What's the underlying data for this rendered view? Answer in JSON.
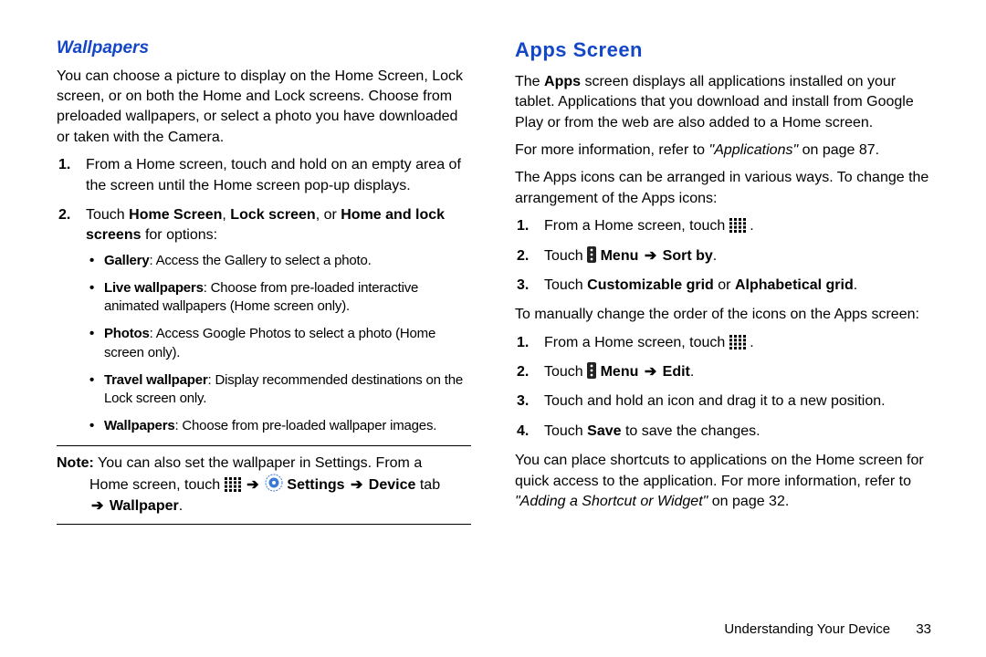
{
  "left": {
    "heading": "Wallpapers",
    "intro": "You can choose a picture to display on the Home Screen, Lock screen, or on both the Home and Lock screens. Choose from preloaded wallpapers, or select a photo you have downloaded or taken with the Camera.",
    "step1": "From a Home screen, touch and hold on an empty area of the screen until the Home screen pop-up displays.",
    "step2_pre": "Touch ",
    "step2_b1": "Home Screen",
    "step2_sep1": ", ",
    "step2_b2": "Lock screen",
    "step2_sep2": ", or ",
    "step2_b3": "Home and lock screens",
    "step2_post": " for options:",
    "b_gallery_b": "Gallery",
    "b_gallery_t": ": Access the Gallery to select a photo.",
    "b_live_b": "Live wallpapers",
    "b_live_t": ": Choose from pre-loaded interactive animated wallpapers (Home screen only).",
    "b_photos_b": "Photos",
    "b_photos_t": ": Access Google Photos to select a photo (Home screen only).",
    "b_travel_b": "Travel wallpaper",
    "b_travel_t": ": Display recommended destinations on the Lock screen only.",
    "b_wall_b": "Wallpapers",
    "b_wall_t": ": Choose from pre-loaded wallpaper images.",
    "note_label": "Note:",
    "note_line1": " You can also set the wallpaper in Settings. From a",
    "note_line2_pre": "Home screen, touch ",
    "note_arrow1": "➔",
    "note_settings": " Settings ",
    "note_arrow2": "➔",
    "note_device": " Device ",
    "note_tab": "tab",
    "note_arrow3": "➔",
    "note_wallpaper": " Wallpaper",
    "note_period": "."
  },
  "right": {
    "heading": "Apps Screen",
    "p1_pre": "The ",
    "p1_b": "Apps",
    "p1_post": " screen displays all applications installed on your tablet. Applications that you download and install from Google Play or from the web are also added to a Home screen.",
    "p2_pre": "For more information, refer to ",
    "p2_i": "\"Applications\"",
    "p2_post": " on page 87.",
    "p3": "The Apps icons can be arranged in various ways. To change the arrangement of the Apps icons:",
    "a_step1_pre": "From a Home screen, touch ",
    "a_step1_post": " .",
    "a_step2_pre": "Touch ",
    "a_step2_b1": " Menu ",
    "a_step2_arrow": "➔",
    "a_step2_b2": " Sort by",
    "a_step2_post": ".",
    "a_step3_pre": "Touch ",
    "a_step3_b1": "Customizable grid",
    "a_step3_mid": " or ",
    "a_step3_b2": "Alphabetical grid",
    "a_step3_post": ".",
    "p4": "To manually change the order of the icons on the Apps screen:",
    "b_step1_pre": "From a Home screen, touch ",
    "b_step1_post": " .",
    "b_step2_pre": "Touch ",
    "b_step2_b1": " Menu ",
    "b_step2_arrow": "➔",
    "b_step2_b2": " Edit",
    "b_step2_post": ".",
    "b_step3": "Touch and hold an icon and drag it to a new position.",
    "b_step4_pre": "Touch ",
    "b_step4_b": "Save",
    "b_step4_post": " to save the changes.",
    "p5_pre": "You can place shortcuts to applications on the Home screen for quick access to the application. For more information, refer to ",
    "p5_i": "\"Adding a Shortcut or Widget\"",
    "p5_post": " on page 32."
  },
  "footer": {
    "text": "Understanding Your Device",
    "page": "33"
  }
}
